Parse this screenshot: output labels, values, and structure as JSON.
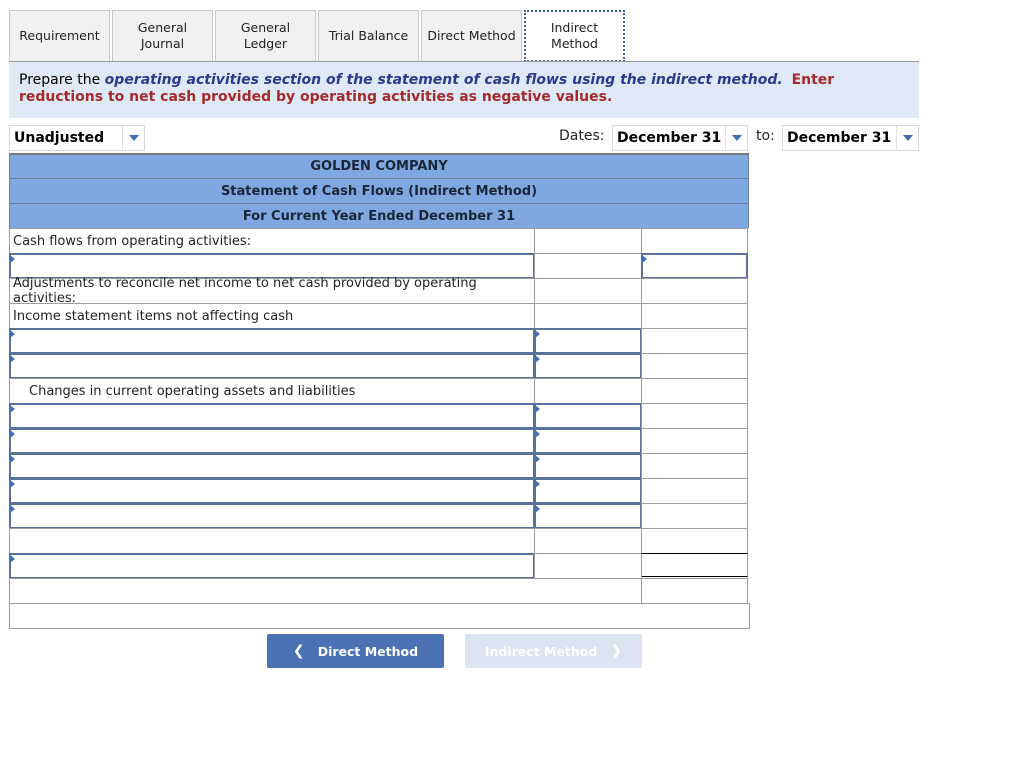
{
  "tabs": [
    {
      "label": "Requirement",
      "active": false
    },
    {
      "label": "General Journal",
      "active": false
    },
    {
      "label": "General Ledger",
      "active": false
    },
    {
      "label": "Trial Balance",
      "active": false
    },
    {
      "label": "Direct Method",
      "active": false
    },
    {
      "label": "Indirect Method",
      "active": true
    }
  ],
  "instructions": {
    "prefix": "Prepare the ",
    "emphasis": "operating activities section of the statement of cash flows using the indirect method.",
    "warning": "Enter reductions to net cash provided by operating activities as negative values."
  },
  "controls": {
    "view_select": "Unadjusted",
    "dates_label": "Dates:",
    "date_from": "December 31",
    "to_label": "to:",
    "date_to": "December 31"
  },
  "statement": {
    "company": "GOLDEN COMPANY",
    "title": "Statement of Cash Flows (Indirect Method)",
    "period": "For Current Year Ended December 31",
    "labels": {
      "operating": "Cash flows from operating activities:",
      "adjustments": "Adjustments to reconcile net income to net cash provided by operating activities:",
      "non_cash": "Income statement items not affecting cash",
      "changes": "Changes in current operating assets and liabilities"
    }
  },
  "navigation": {
    "prev_label": "Direct Method",
    "next_label": "Indirect Method",
    "prev_icon": "chevron-left-icon",
    "next_icon": "chevron-right-icon"
  }
}
